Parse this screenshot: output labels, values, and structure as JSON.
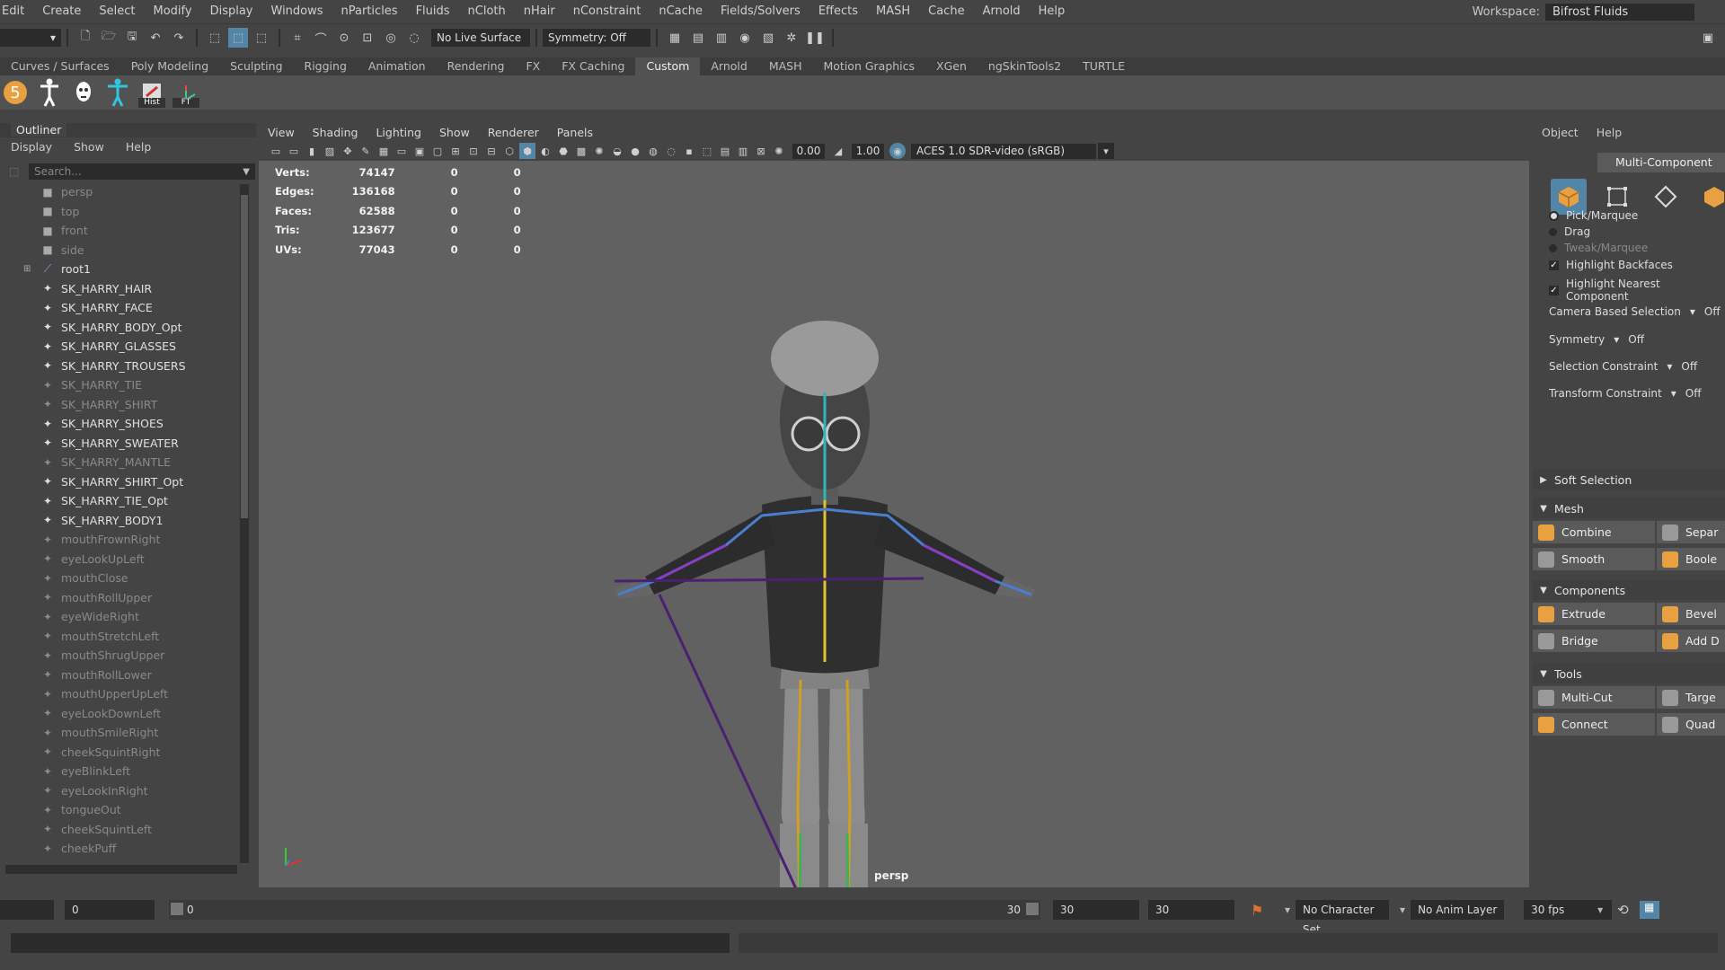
{
  "menubar": {
    "items": [
      "Edit",
      "Create",
      "Select",
      "Modify",
      "Display",
      "Windows",
      "nParticles",
      "Fluids",
      "nCloth",
      "nHair",
      "nConstraint",
      "nCache",
      "Fields/Solvers",
      "Effects",
      "MASH",
      "Cache",
      "Arnold",
      "Help"
    ],
    "workspace_label": "Workspace:",
    "workspace_value": "Bifrost Fluids"
  },
  "statusline": {
    "live_surface": "No Live Surface",
    "symmetry": "Symmetry: Off"
  },
  "shelf": {
    "tabs": [
      "Curves / Surfaces",
      "Poly Modeling",
      "Sculpting",
      "Rigging",
      "Animation",
      "Rendering",
      "FX",
      "FX Caching",
      "Custom",
      "Arnold",
      "MASH",
      "Motion Graphics",
      "XGen",
      "ngSkinTools2",
      "TURTLE"
    ],
    "active_tab": "Custom",
    "hist_caption": "Hist",
    "ft_caption": "FT"
  },
  "outliner": {
    "title": "Outliner",
    "menu": [
      "Display",
      "Show",
      "Help"
    ],
    "search_placeholder": "Search...",
    "items": [
      {
        "label": "persp",
        "type": "camera",
        "dim": true
      },
      {
        "label": "top",
        "type": "camera",
        "dim": true
      },
      {
        "label": "front",
        "type": "camera",
        "dim": true
      },
      {
        "label": "side",
        "type": "camera",
        "dim": true
      },
      {
        "label": "root1",
        "type": "joint",
        "dim": false,
        "expandable": true
      },
      {
        "label": "SK_HARRY_HAIR",
        "type": "mesh",
        "dim": false
      },
      {
        "label": "SK_HARRY_FACE",
        "type": "mesh",
        "dim": false
      },
      {
        "label": "SK_HARRY_BODY_Opt",
        "type": "mesh",
        "dim": false
      },
      {
        "label": "SK_HARRY_GLASSES",
        "type": "mesh",
        "dim": false
      },
      {
        "label": "SK_HARRY_TROUSERS",
        "type": "mesh",
        "dim": false
      },
      {
        "label": "SK_HARRY_TIE",
        "type": "mesh",
        "dim": true
      },
      {
        "label": "SK_HARRY_SHIRT",
        "type": "mesh",
        "dim": true
      },
      {
        "label": "SK_HARRY_SHOES",
        "type": "mesh",
        "dim": false
      },
      {
        "label": "SK_HARRY_SWEATER",
        "type": "mesh",
        "dim": false
      },
      {
        "label": "SK_HARRY_MANTLE",
        "type": "mesh",
        "dim": true
      },
      {
        "label": "SK_HARRY_SHIRT_Opt",
        "type": "mesh",
        "dim": false
      },
      {
        "label": "SK_HARRY_TIE_Opt",
        "type": "mesh",
        "dim": false
      },
      {
        "label": "SK_HARRY_BODY1",
        "type": "mesh",
        "dim": false
      },
      {
        "label": "mouthFrownRight",
        "type": "mesh",
        "dim": true
      },
      {
        "label": "eyeLookUpLeft",
        "type": "mesh",
        "dim": true
      },
      {
        "label": "mouthClose",
        "type": "mesh",
        "dim": true
      },
      {
        "label": "mouthRollUpper",
        "type": "mesh",
        "dim": true
      },
      {
        "label": "eyeWideRight",
        "type": "mesh",
        "dim": true
      },
      {
        "label": "mouthStretchLeft",
        "type": "mesh",
        "dim": true
      },
      {
        "label": "mouthShrugUpper",
        "type": "mesh",
        "dim": true
      },
      {
        "label": "mouthRollLower",
        "type": "mesh",
        "dim": true
      },
      {
        "label": "mouthUpperUpLeft",
        "type": "mesh",
        "dim": true
      },
      {
        "label": "eyeLookDownLeft",
        "type": "mesh",
        "dim": true
      },
      {
        "label": "mouthSmileRight",
        "type": "mesh",
        "dim": true
      },
      {
        "label": "cheekSquintRight",
        "type": "mesh",
        "dim": true
      },
      {
        "label": "eyeBlinkLeft",
        "type": "mesh",
        "dim": true
      },
      {
        "label": "eyeLookInRight",
        "type": "mesh",
        "dim": true
      },
      {
        "label": "tongueOut",
        "type": "mesh",
        "dim": true
      },
      {
        "label": "cheekSquintLeft",
        "type": "mesh",
        "dim": true
      },
      {
        "label": "cheekPuff",
        "type": "mesh",
        "dim": true
      }
    ]
  },
  "viewport": {
    "menu": [
      "View",
      "Shading",
      "Lighting",
      "Show",
      "Renderer",
      "Panels"
    ],
    "exposure": "0.00",
    "gamma": "1.00",
    "color_space": "ACES 1.0 SDR-video (sRGB)",
    "camera_label": "persp",
    "hud": [
      {
        "label": "Verts:",
        "value": "74147",
        "a": "0",
        "b": "0"
      },
      {
        "label": "Edges:",
        "value": "136168",
        "a": "0",
        "b": "0"
      },
      {
        "label": "Faces:",
        "value": "62588",
        "a": "0",
        "b": "0"
      },
      {
        "label": "Tris:",
        "value": "123677",
        "a": "0",
        "b": "0"
      },
      {
        "label": "UVs:",
        "value": "77043",
        "a": "0",
        "b": "0"
      }
    ]
  },
  "modeling_toolkit": {
    "menu": [
      "Object",
      "Help"
    ],
    "mode_label": "Multi-Component",
    "selection_modes": [
      {
        "label": "Pick/Marquee",
        "state": "on"
      },
      {
        "label": "Drag",
        "state": "off"
      },
      {
        "label": "Tweak/Marquee",
        "state": "disabled"
      }
    ],
    "checks": [
      {
        "label": "Highlight Backfaces",
        "checked": true
      },
      {
        "label": "Highlight Nearest Component",
        "checked": true
      }
    ],
    "options": [
      {
        "label": "Camera Based Selection",
        "value": "Off"
      },
      {
        "label": "Symmetry",
        "value": "Off"
      },
      {
        "label": "Selection Constraint",
        "value": "Off"
      },
      {
        "label": "Transform Constraint",
        "value": "Off"
      }
    ],
    "soft_selection": "Soft Selection",
    "sections": [
      {
        "title": "Mesh",
        "buttons": [
          [
            "Combine",
            "Separ"
          ],
          [
            "Smooth",
            "Boole"
          ]
        ]
      },
      {
        "title": "Components",
        "buttons": [
          [
            "Extrude",
            "Bevel"
          ],
          [
            "Bridge",
            "Add D"
          ]
        ]
      },
      {
        "title": "Tools",
        "buttons": [
          [
            "Multi-Cut",
            "Targe"
          ],
          [
            "Connect",
            "Quad"
          ]
        ]
      }
    ]
  },
  "timeslider": {
    "current_frame": "0",
    "range_start": "0",
    "range_end": "30",
    "end_a": "30",
    "end_b": "30",
    "character_set": "No Character Set",
    "anim_layer": "No Anim Layer",
    "fps": "30 fps"
  },
  "colors": {
    "accent_blue": "#5285a6",
    "ui_bg": "#444444",
    "viewport_bg": "#616161",
    "field_bg": "#2b2b2b",
    "orange_icon": "#e8a040"
  }
}
